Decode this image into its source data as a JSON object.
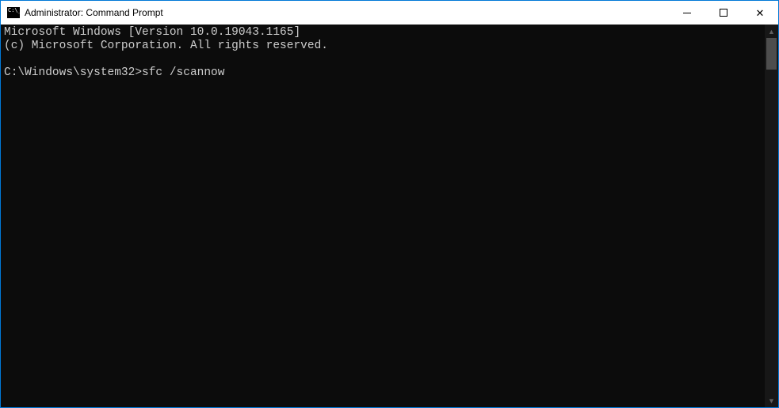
{
  "titlebar": {
    "title": "Administrator: Command Prompt"
  },
  "terminal": {
    "line1": "Microsoft Windows [Version 10.0.19043.1165]",
    "line2": "(c) Microsoft Corporation. All rights reserved.",
    "blank": "",
    "prompt": "C:\\Windows\\system32>",
    "command": "sfc /scannow"
  }
}
